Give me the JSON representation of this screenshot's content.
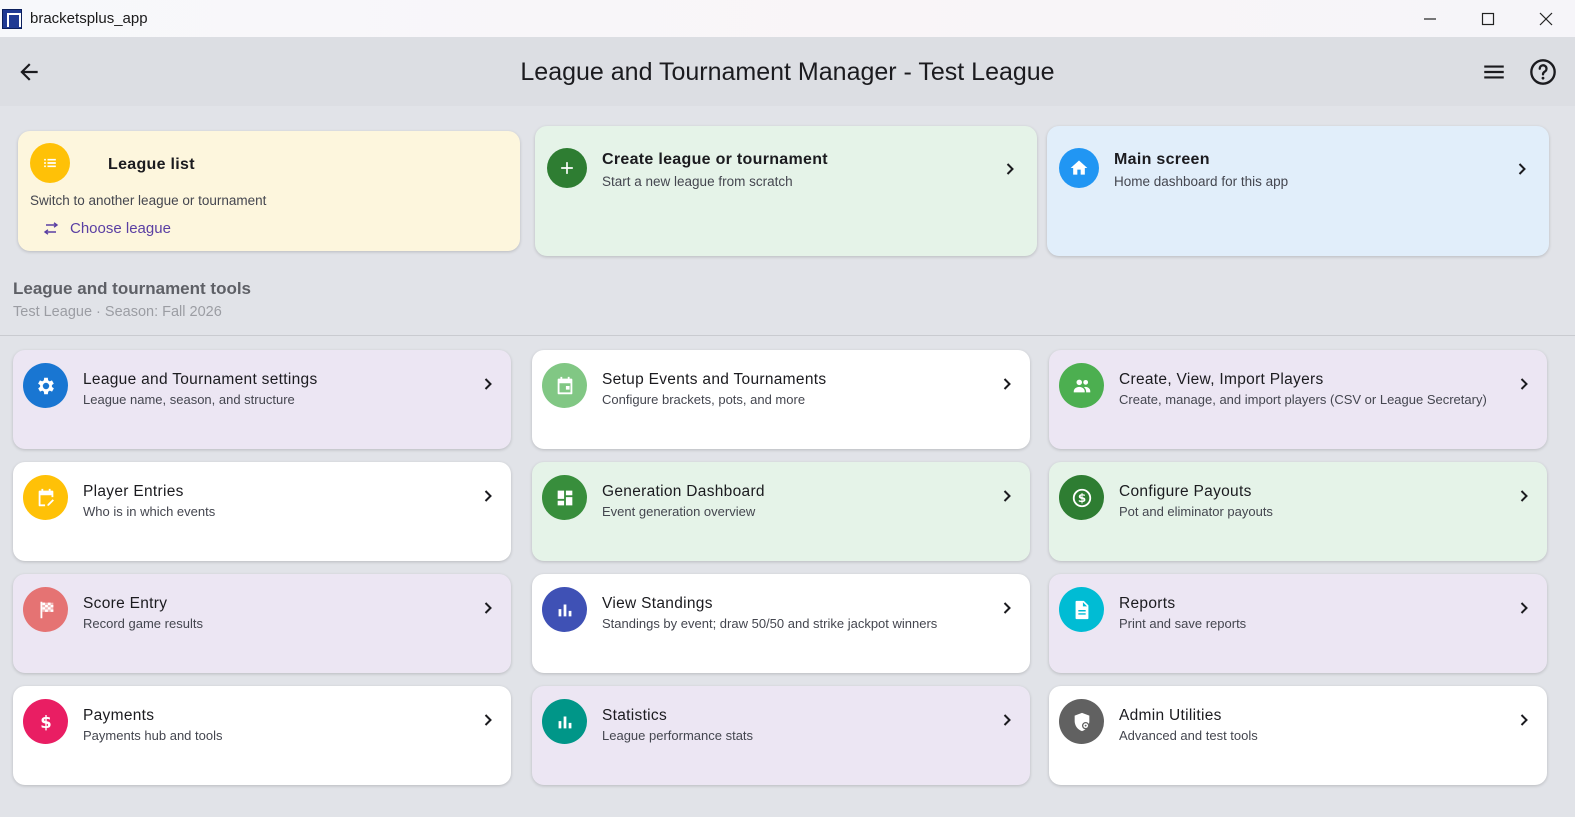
{
  "window": {
    "app_title": "bracketsplus_app"
  },
  "appbar": {
    "title": "League and Tournament Manager - Test League"
  },
  "league_card": {
    "title": "League list",
    "subtitle": "Switch to another league or tournament",
    "link": "Choose league"
  },
  "create_card": {
    "title": "Create league or tournament",
    "subtitle": "Start a new league from scratch"
  },
  "main_card": {
    "title": "Main screen",
    "subtitle": "Home dashboard for this app"
  },
  "section": {
    "title": "League and tournament tools",
    "subtitle": "Test League · Season: Fall 2026"
  },
  "tools": [
    {
      "title": "League and Tournament settings",
      "subtitle": "League name, season, and structure",
      "icon": "gear-icon",
      "color": "#1976d2"
    },
    {
      "title": "Setup Events and Tournaments",
      "subtitle": "Configure brackets, pots, and more",
      "icon": "calendar-icon",
      "color": "#81c784"
    },
    {
      "title": "Create, View, Import Players",
      "subtitle": "Create, manage, and import players (CSV or League Secretary)",
      "icon": "people-icon",
      "color": "#4caf50"
    },
    {
      "title": "Player Entries",
      "subtitle": "Who is in which events",
      "icon": "calendar-edit-icon",
      "color": "#ffc107"
    },
    {
      "title": "Generation Dashboard",
      "subtitle": "Event generation overview",
      "icon": "dashboard-icon",
      "color": "#388e3c"
    },
    {
      "title": "Configure Payouts",
      "subtitle": "Pot and eliminator payouts",
      "icon": "dollar-circle-icon",
      "color": "#2e7d32"
    },
    {
      "title": "Score Entry",
      "subtitle": "Record game results",
      "icon": "checkered-flag-icon",
      "color": "#e57373"
    },
    {
      "title": "View Standings",
      "subtitle": "Standings by event; draw 50/50 and strike jackpot winners",
      "icon": "bar-chart-icon",
      "color": "#3f51b5"
    },
    {
      "title": "Reports",
      "subtitle": "Print and save reports",
      "icon": "document-icon",
      "color": "#00bcd4"
    },
    {
      "title": "Payments",
      "subtitle": "Payments hub and tools",
      "icon": "dollar-icon",
      "color": "#e91e63"
    },
    {
      "title": "Statistics",
      "subtitle": "League performance stats",
      "icon": "bar-chart-icon",
      "color": "#009688"
    },
    {
      "title": "Admin Utilities",
      "subtitle": "Advanced and test tools",
      "icon": "admin-shield-icon",
      "color": "#616161"
    }
  ]
}
